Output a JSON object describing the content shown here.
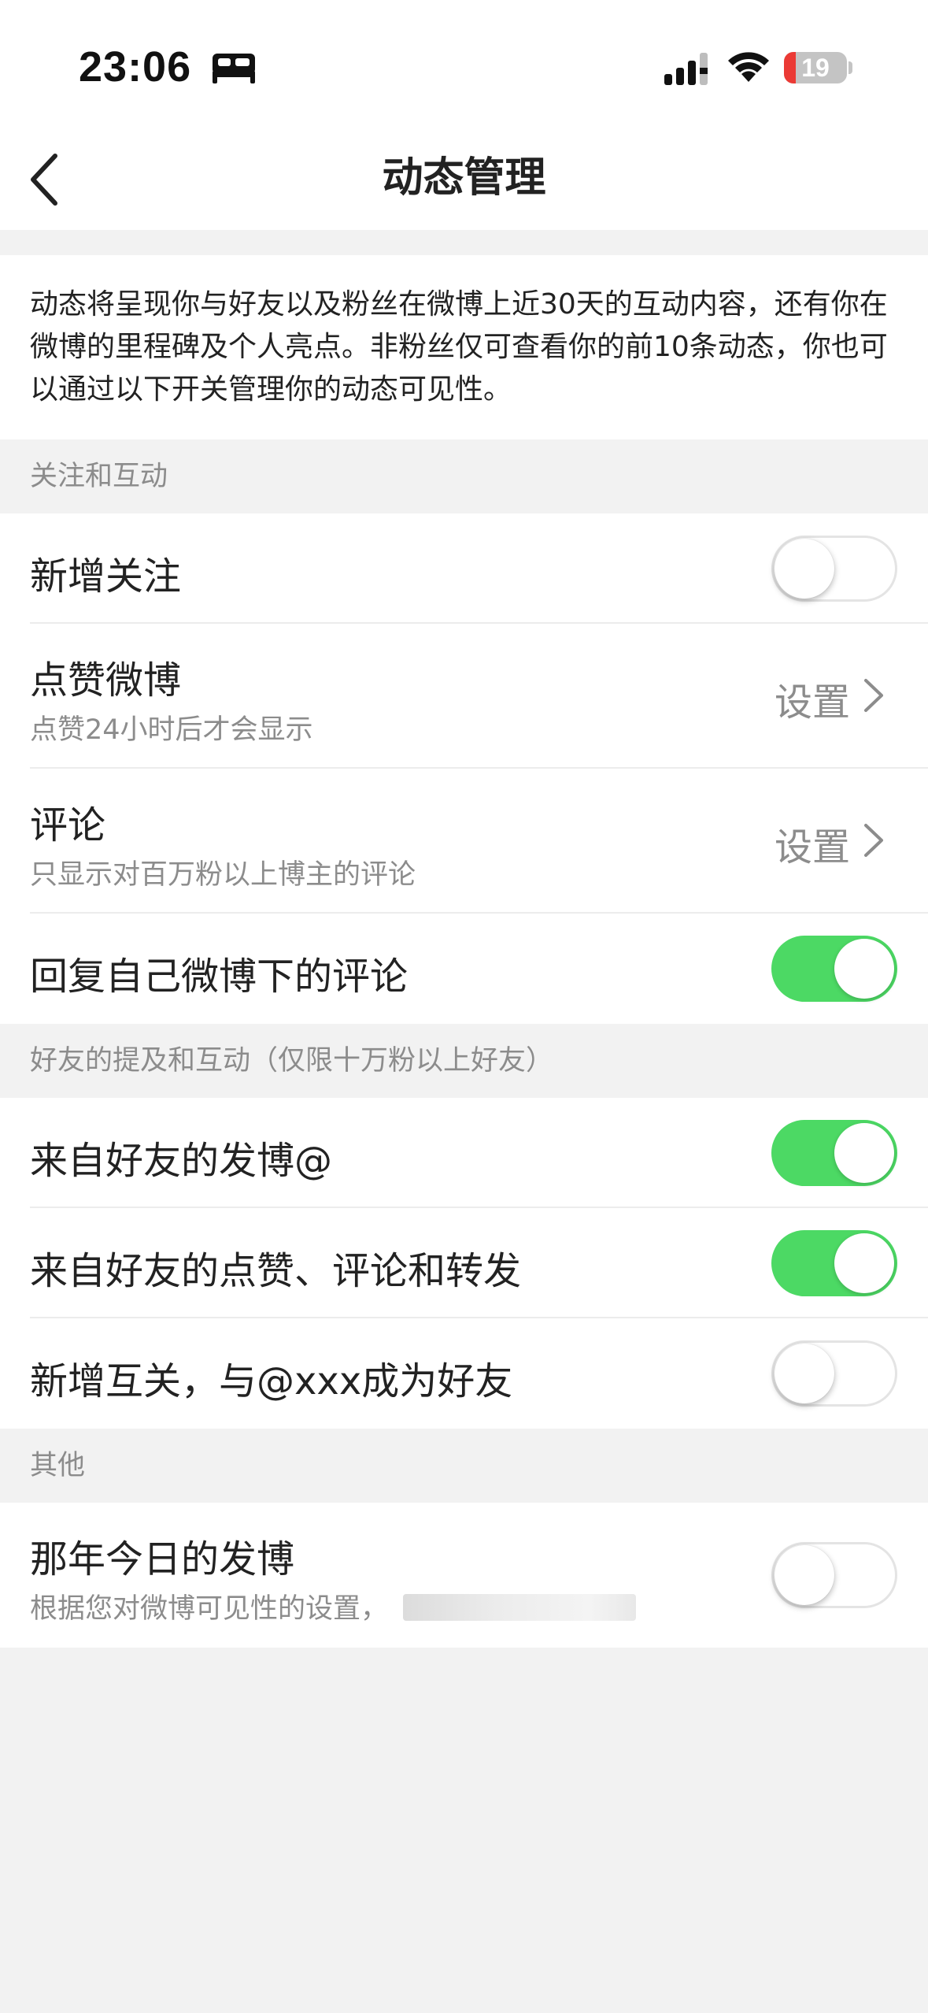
{
  "status_bar": {
    "time": "23:06",
    "battery_level": "19",
    "battery_fraction": 0.19,
    "icons": [
      "sleep-focus-icon",
      "cellular-signal-icon",
      "wifi-icon",
      "battery-icon"
    ]
  },
  "nav": {
    "title": "动态管理",
    "back_icon": "chevron-left-icon"
  },
  "intro": {
    "text": "动态将呈现你与好友以及粉丝在微博上近30天的互动内容，还有你在微博的里程碑及个人亮点。非粉丝仅可查看你的前10条动态，你也可以通过以下开关管理你的动态可见性。"
  },
  "sections": [
    {
      "header": "关注和互动",
      "rows": [
        {
          "title": "新增关注",
          "control": "toggle",
          "on": false
        },
        {
          "title": "点赞微博",
          "subtitle": "点赞24小时后才会显示",
          "control": "link",
          "link_label": "设置"
        },
        {
          "title": "评论",
          "subtitle": "只显示对百万粉以上博主的评论",
          "control": "link",
          "link_label": "设置"
        },
        {
          "title": "回复自己微博下的评论",
          "control": "toggle",
          "on": true
        }
      ]
    },
    {
      "header": "好友的提及和互动（仅限十万粉以上好友）",
      "rows": [
        {
          "title": "来自好友的发博@",
          "control": "toggle",
          "on": true
        },
        {
          "title": "来自好友的点赞、评论和转发",
          "control": "toggle",
          "on": true
        },
        {
          "title": "新增互关，与@xxx成为好友",
          "control": "toggle",
          "on": false
        }
      ]
    },
    {
      "header": "其他",
      "rows": [
        {
          "title": "那年今日的发博",
          "subtitle": "根据您对微博可见性的设置，",
          "control": "toggle",
          "on": false
        }
      ]
    }
  ],
  "colors": {
    "toggle_on": "#4cd964",
    "background": "#f2f2f2",
    "battery_low": "#eb3a35"
  }
}
